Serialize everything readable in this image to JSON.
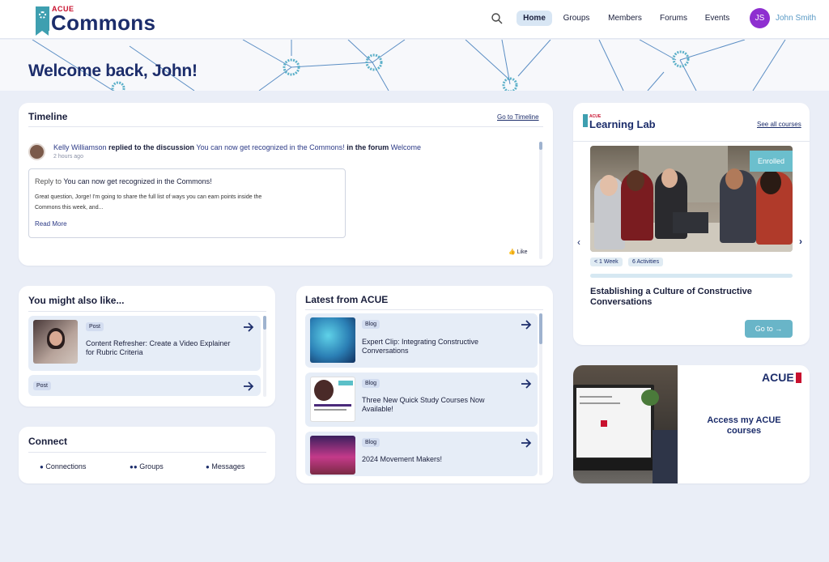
{
  "header": {
    "brand_small": "ACUE",
    "brand_name": "Commons",
    "nav": [
      {
        "label": "Home",
        "active": true
      },
      {
        "label": "Groups"
      },
      {
        "label": "Members"
      },
      {
        "label": "Forums"
      },
      {
        "label": "Events"
      }
    ],
    "user_initials": "JS",
    "user_name": "John Smith",
    "avatar_color": "#8e2fd0"
  },
  "banner": {
    "welcome": "Welcome back, John!"
  },
  "timeline": {
    "title": "Timeline",
    "link": "Go to Timeline",
    "entry": {
      "user": "Kelly Williamson",
      "action": "replied to the discussion",
      "topic": "You can now get recognized in the Commons!",
      "in_forum": "in the forum",
      "forum": "Welcome",
      "time": "2 hours ago",
      "reply_to_label": "Reply to",
      "reply_title": "You can now get recognized in the Commons!",
      "reply_body_1": "Great question, Jorge! I'm going to share the full list of ways you can earn points inside the",
      "reply_body_2": "Commons this week, and...",
      "read_more": "Read More",
      "like": "Like"
    }
  },
  "you_might_like": {
    "title": "You might also like...",
    "items": [
      {
        "tag": "Post",
        "title_1": "Content Refresher: Create a Video Explainer",
        "title_2": "for Rubric Criteria"
      },
      {
        "tag": "Post"
      }
    ]
  },
  "latest": {
    "title": "Latest from ACUE",
    "items": [
      {
        "tag": "Blog",
        "title_1": "Expert Clip: Integrating Constructive",
        "title_2": "Conversations"
      },
      {
        "tag": "Blog",
        "title_1": "Three New Quick Study Courses Now",
        "title_2": "Available!"
      },
      {
        "tag": "Blog",
        "title_1": "2024 Movement Makers!"
      }
    ]
  },
  "connect": {
    "title": "Connect",
    "links": [
      "Connections",
      "Groups",
      "Messages"
    ]
  },
  "learning_lab": {
    "brand_small": "ACUE",
    "brand": "Learning Lab",
    "link": "See all courses",
    "badge": "Enrolled",
    "pills": [
      "< 1 Week",
      "6 Activities"
    ],
    "course_1": "Establishing a Culture of Constructive",
    "course_2": "Conversations",
    "cta": "Go to →"
  },
  "access": {
    "brand": "ACUE",
    "text_1": "Access my ACUE",
    "text_2": "courses"
  },
  "colors": {
    "brand_navy": "#1c2d6b",
    "teal": "#3e9fb0",
    "accent_red": "#c8102e"
  }
}
